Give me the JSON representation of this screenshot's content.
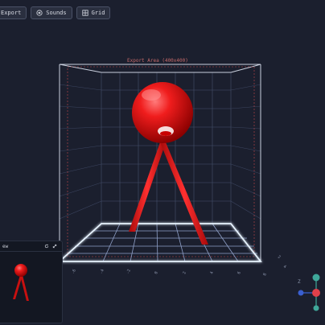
{
  "toolbar": {
    "export_label": "Export",
    "sounds_label": "Sounds",
    "grid_label": "Grid"
  },
  "scene": {
    "export_area_label": "Export Area (400x400)",
    "axis_ticks": [
      "-6",
      "-4",
      "-2",
      "0",
      "2",
      "4",
      "6"
    ],
    "ball_color": "#e01414",
    "grid_color": "#8fa0c8",
    "floor_color": "#e8f4ff"
  },
  "preview": {
    "title": "ew"
  },
  "gizmo": {
    "y_color": "#3fa89a",
    "x_color": "#e0404a",
    "z_color": "#3a5fd0",
    "z_label": "Z"
  }
}
